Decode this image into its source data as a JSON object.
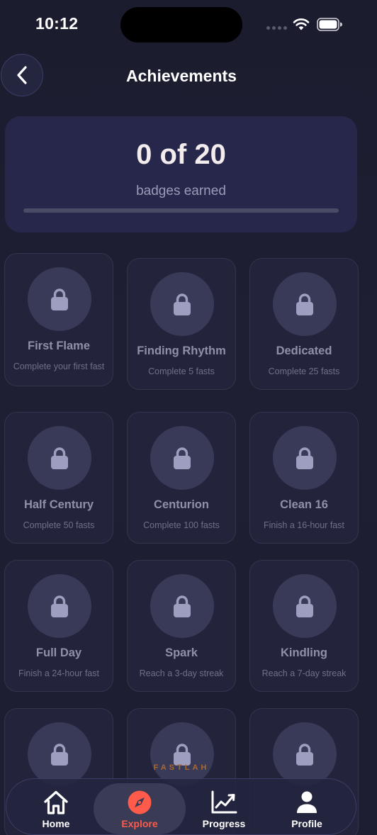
{
  "status_bar": {
    "time": "10:12"
  },
  "header": {
    "title": "Achievements"
  },
  "summary": {
    "count": "0 of 20",
    "label": "badges earned",
    "progress": 0
  },
  "badges": [
    {
      "title": "First Flame",
      "desc": "Complete your first fast",
      "locked": true
    },
    {
      "title": "Finding Rhythm",
      "desc": "Complete 5 fasts",
      "locked": true
    },
    {
      "title": "Dedicated",
      "desc": "Complete 25 fasts",
      "locked": true
    },
    {
      "title": "Half Century",
      "desc": "Complete 50 fasts",
      "locked": true
    },
    {
      "title": "Centurion",
      "desc": "Complete 100 fasts",
      "locked": true
    },
    {
      "title": "Clean 16",
      "desc": "Finish a 16-hour fast",
      "locked": true
    },
    {
      "title": "Full Day",
      "desc": "Finish a 24-hour fast",
      "locked": true
    },
    {
      "title": "Spark",
      "desc": "Reach a 3-day streak",
      "locked": true
    },
    {
      "title": "Kindling",
      "desc": "Reach a 7-day streak",
      "locked": true
    },
    {
      "title": "",
      "desc": "",
      "locked": true
    },
    {
      "title": "",
      "desc": "",
      "locked": true
    },
    {
      "title": "",
      "desc": "",
      "locked": true
    }
  ],
  "brand": "FASTLAH",
  "tabs": [
    {
      "label": "Home",
      "icon": "home-icon",
      "active": false
    },
    {
      "label": "Explore",
      "icon": "compass-icon",
      "active": true
    },
    {
      "label": "Progress",
      "icon": "trend-chart-icon",
      "active": false
    },
    {
      "label": "Profile",
      "icon": "person-icon",
      "active": false
    }
  ],
  "colors": {
    "background": "#1d1e31",
    "card": "#23243b",
    "summary_card": "#26274a",
    "accent": "#ff5a4a",
    "muted_text": "#8f90aa",
    "brand": "#a8682e"
  }
}
